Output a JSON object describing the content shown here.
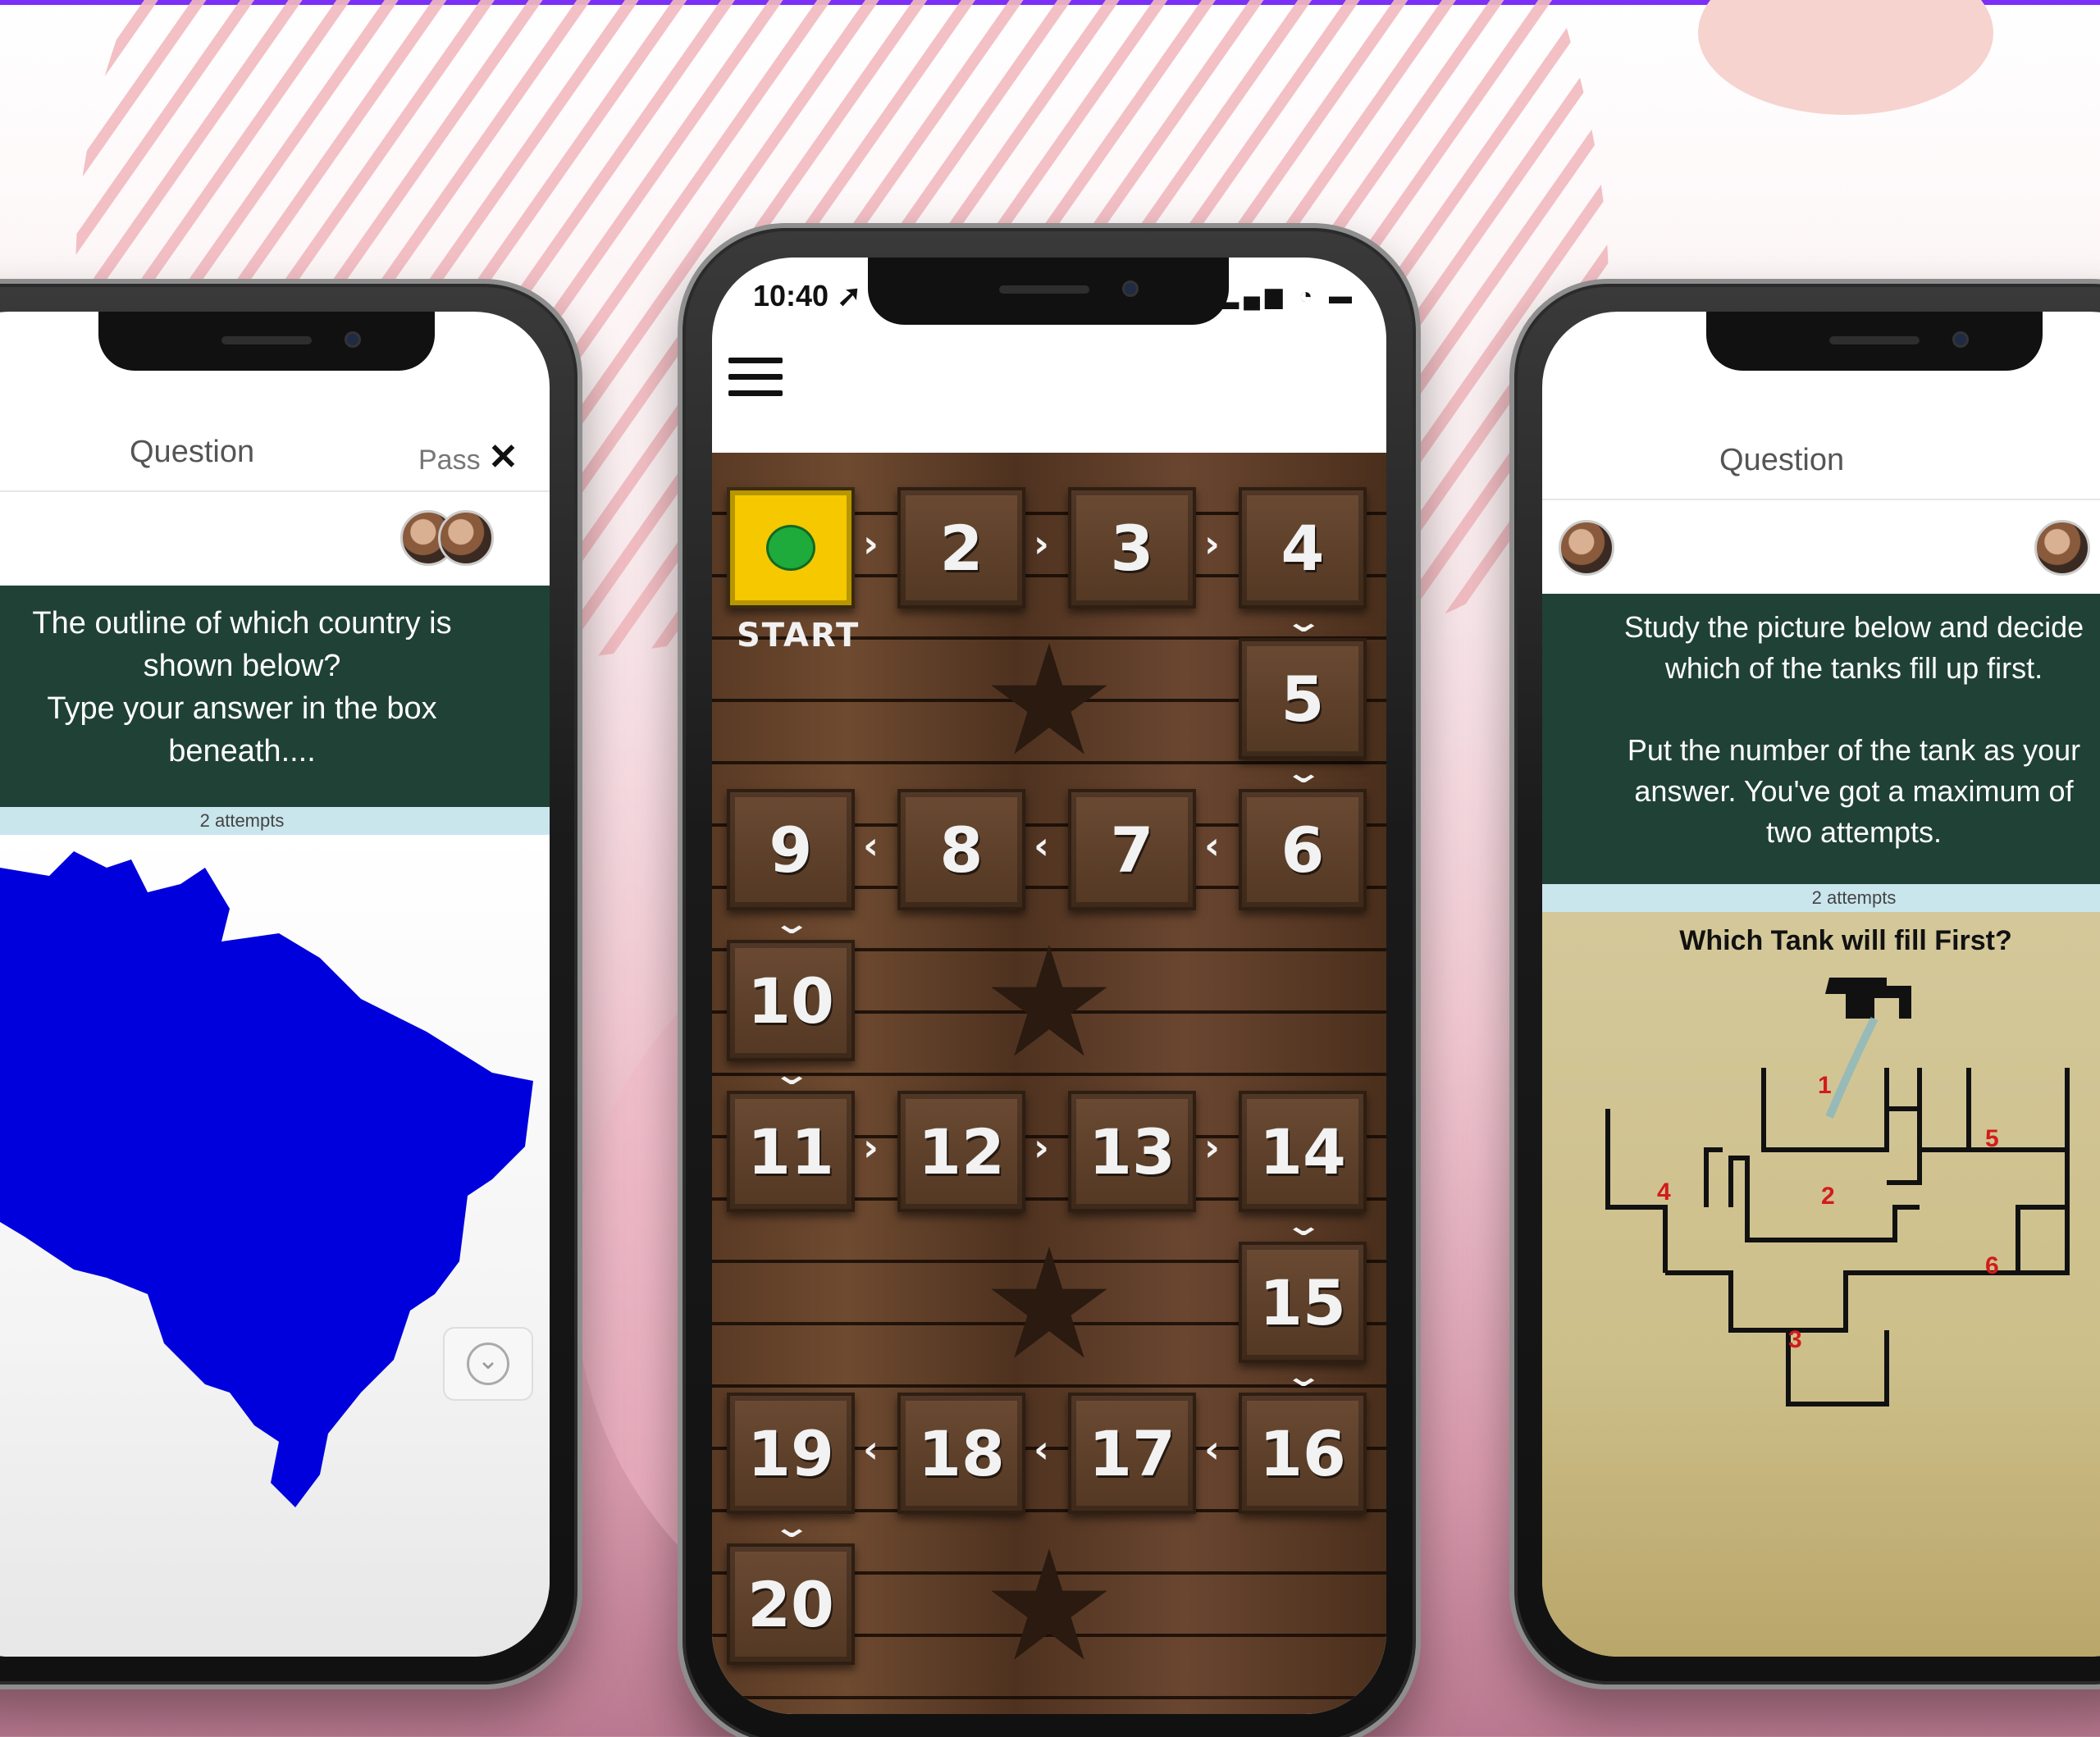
{
  "left_phone": {
    "header_title": "Question",
    "pass_label": "Pass",
    "close_glyph": "✕",
    "question_lines": [
      "The outline of which country is",
      "shown below?",
      "Type your answer in the box",
      "beneath...."
    ],
    "attempts": "2 attempts",
    "map_color": "#0000dd",
    "chevron_glyph": "⌄"
  },
  "middle_phone": {
    "status_time": "10:40 ➚",
    "status_icons": "▂▄▆ ◔ ▬",
    "start_label": "START",
    "tiles": [
      "2",
      "3",
      "4",
      "5",
      "9",
      "8",
      "7",
      "6",
      "10",
      "11",
      "12",
      "13",
      "14",
      "15",
      "19",
      "18",
      "17",
      "16",
      "20"
    ],
    "arrow_right": "›",
    "arrow_left": "‹",
    "arrow_down": "⌄"
  },
  "right_phone": {
    "header_title": "Question",
    "question_lines": [
      "Study the picture below and decide",
      "which of the tanks fill up first.",
      "",
      "Put the number of the tank as your",
      "answer. You've got a maximum of",
      "two attempts."
    ],
    "attempts": "2 attempts",
    "image_title": "Which Tank will fill First?",
    "tank_labels": [
      "1",
      "2",
      "3",
      "4",
      "5",
      "6"
    ]
  },
  "colors": {
    "accent_top": "#7b2ff7",
    "question_bg": "#1f4136",
    "start_tile": "#f5c800",
    "start_dot": "#1faa3c"
  }
}
